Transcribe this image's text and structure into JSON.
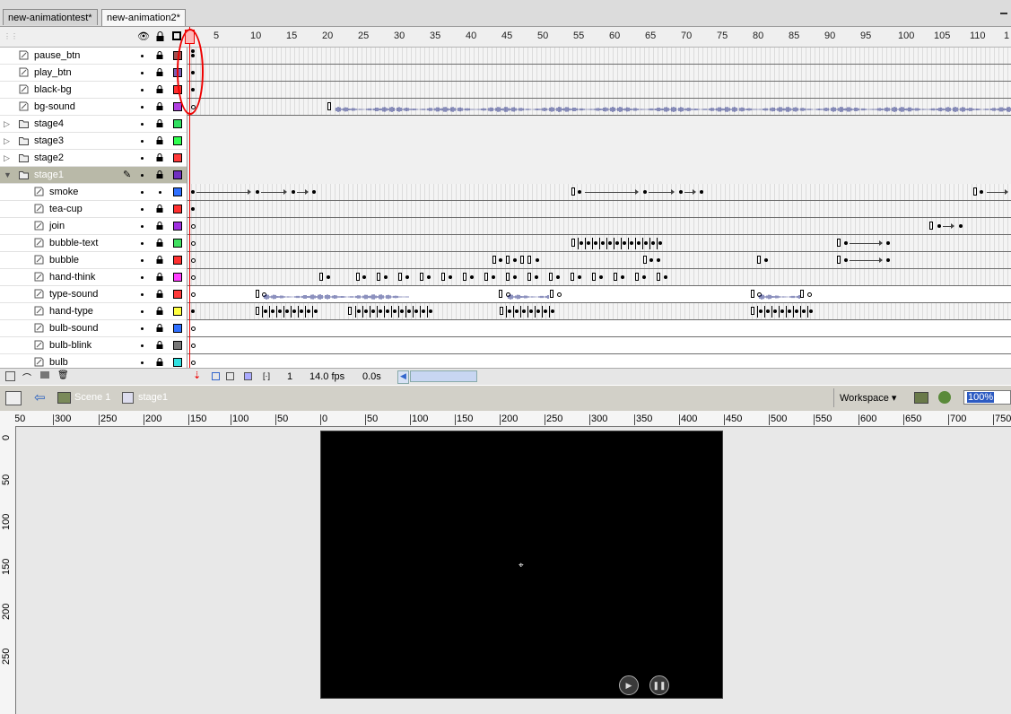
{
  "tabs": [
    "new-animationtest*",
    "new-animation2*"
  ],
  "timeline": {
    "frame_numbers": [
      "1",
      "5",
      "10",
      "15",
      "20",
      "25",
      "30",
      "35",
      "40",
      "45",
      "50",
      "55",
      "60",
      "65",
      "70",
      "75",
      "80",
      "85",
      "90",
      "95",
      "100",
      "105",
      "110",
      "1"
    ],
    "layers": [
      {
        "name": "pause_btn",
        "color": "#a05050",
        "kind": "layer"
      },
      {
        "name": "play_btn",
        "color": "#7a5fb5",
        "kind": "layer"
      },
      {
        "name": "black-bg",
        "color": "#ff3030",
        "kind": "layer"
      },
      {
        "name": "bg-sound",
        "color": "#b040e0",
        "kind": "layer"
      },
      {
        "name": "stage4",
        "color": "#30e060",
        "kind": "folder"
      },
      {
        "name": "stage3",
        "color": "#30ff50",
        "kind": "folder"
      },
      {
        "name": "stage2",
        "color": "#ff3a3a",
        "kind": "folder"
      },
      {
        "name": "stage1",
        "color": "#7030c0",
        "kind": "folder-open"
      },
      {
        "name": "smoke",
        "color": "#3070ff",
        "kind": "child"
      },
      {
        "name": "tea-cup",
        "color": "#ff3030",
        "kind": "child"
      },
      {
        "name": "join",
        "color": "#a030e0",
        "kind": "child"
      },
      {
        "name": "bubble-text",
        "color": "#40e060",
        "kind": "child"
      },
      {
        "name": "bubble",
        "color": "#ff3030",
        "kind": "child"
      },
      {
        "name": "hand-think",
        "color": "#ff40ff",
        "kind": "child"
      },
      {
        "name": "type-sound",
        "color": "#ff3a3a",
        "kind": "child"
      },
      {
        "name": "hand-type",
        "color": "#ffff40",
        "kind": "child"
      },
      {
        "name": "bulb-sound",
        "color": "#3070ff",
        "kind": "child"
      },
      {
        "name": "bulb-blink",
        "color": "#777777",
        "kind": "child"
      },
      {
        "name": "bulb",
        "color": "#30e0e0",
        "kind": "child"
      }
    ],
    "status": {
      "current_frame": "1",
      "fps": "14.0 fps",
      "elapsed": "0.0s"
    }
  },
  "edit_bar": {
    "scene": "Scene 1",
    "symbol": "stage1",
    "workspace": "Workspace",
    "zoom": "100%"
  },
  "rulers": {
    "h": [
      "50",
      "300",
      "250",
      "200",
      "150",
      "100",
      "50",
      "0",
      "50",
      "100",
      "150",
      "200",
      "250",
      "300",
      "350",
      "400",
      "450",
      "500",
      "550",
      "600",
      "650",
      "700",
      "750"
    ],
    "v": [
      "0",
      "50",
      "100",
      "150",
      "200",
      "250"
    ]
  }
}
